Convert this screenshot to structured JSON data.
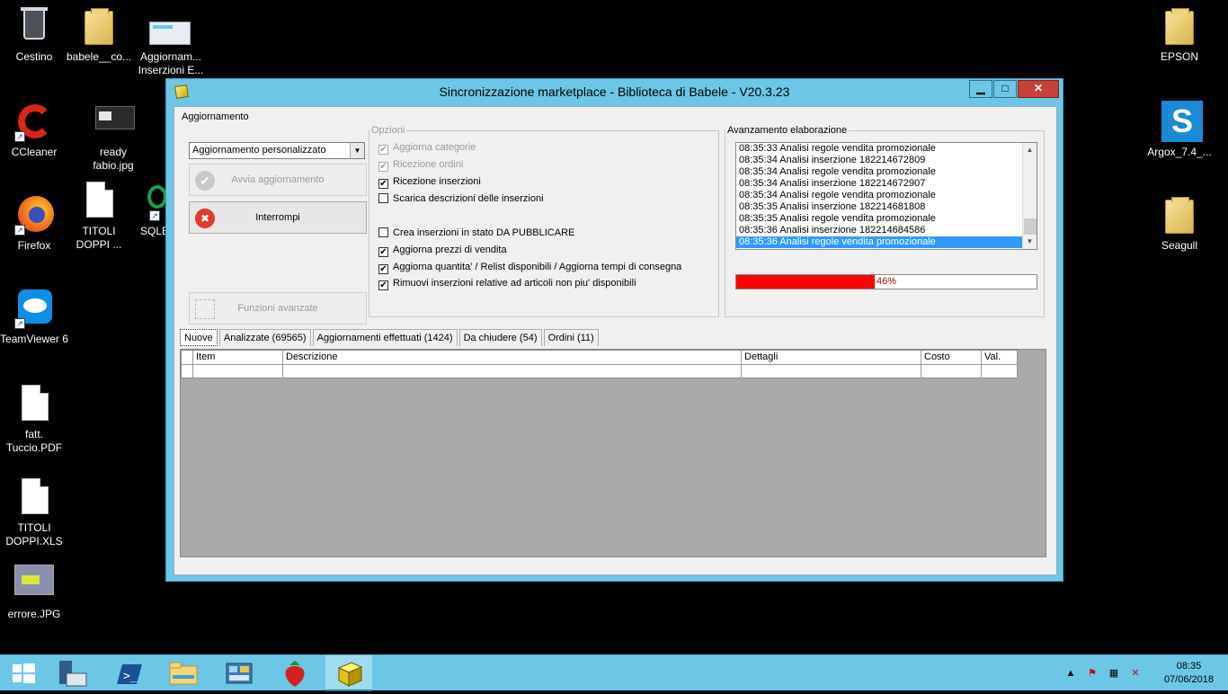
{
  "desktop": {
    "icons": [
      {
        "label": "Cestino",
        "icon": "recycle-bin-icon"
      },
      {
        "label": "babele__co...",
        "icon": "folder-icon"
      },
      {
        "label": "Aggiornam... Inserzioni E...",
        "icon": "screenshot-icon"
      },
      {
        "label": "CCleaner",
        "icon": "ccleaner-icon"
      },
      {
        "label": "ready fabio.jpg",
        "icon": "image-file-icon"
      },
      {
        "label": "TITOLI DOPPI ...",
        "icon": "document-icon"
      },
      {
        "label": "SQLB",
        "icon": "sql-icon"
      },
      {
        "label": "Firefox",
        "icon": "firefox-icon"
      },
      {
        "label": "TeamViewer 6",
        "icon": "teamviewer-icon"
      },
      {
        "label": "fatt. Tuccio.PDF",
        "icon": "document-icon"
      },
      {
        "label": "TITOLI DOPPI.XLS",
        "icon": "document-icon"
      },
      {
        "label": "errore.JPG",
        "icon": "image-file-icon"
      },
      {
        "label": "EPSON",
        "icon": "folder-icon"
      },
      {
        "label": "Argox_7.4_...",
        "icon": "argox-icon"
      },
      {
        "label": "Seagull",
        "icon": "folder-icon"
      }
    ]
  },
  "window": {
    "title": "Sincronizzazione marketplace - Biblioteca di Babele - V20.3.23",
    "controls": {
      "minimize": "▁",
      "maximize": "□",
      "close": "✕"
    }
  },
  "aggiornamento": {
    "legend": "Aggiornamento",
    "select_value": "Aggiornamento personalizzato",
    "start_button": "Avvia aggiornamento",
    "stop_button": "Interrompi",
    "advanced_button": "Funzioni avanzate"
  },
  "opzioni": {
    "legend": "Opzioni",
    "checkboxes": [
      {
        "label": "Aggiorna categorie",
        "checked": true,
        "enabled": false
      },
      {
        "label": "Ricezione ordini",
        "checked": true,
        "enabled": false
      },
      {
        "label": "Ricezione inserzioni",
        "checked": true,
        "enabled": true
      },
      {
        "label": "Scarica descrizioni delle inserzioni",
        "checked": false,
        "enabled": true
      },
      {
        "label": "Crea inserzioni in stato DA PUBBLICARE",
        "checked": false,
        "enabled": true
      },
      {
        "label": "Aggiorna prezzi di vendita",
        "checked": true,
        "enabled": true
      },
      {
        "label": "Aggiorna quantita' / Relist disponibili / Aggiorna tempi di consegna",
        "checked": true,
        "enabled": true
      },
      {
        "label": "Rimuovi inserzioni relative ad articoli non piu' disponibili",
        "checked": true,
        "enabled": true
      }
    ]
  },
  "avanzamento": {
    "legend": "Avanzamento elaborazione",
    "log": [
      "08:35:33 Analisi regole vendita promozionale",
      "08:35:34 Analisi inserzione 182214672809",
      "08:35:34 Analisi regole vendita promozionale",
      "08:35:34 Analisi inserzione 182214672907",
      "08:35:34 Analisi regole vendita promozionale",
      "08:35:35 Analisi inserzione 182214681808",
      "08:35:35 Analisi regole vendita promozionale",
      "08:35:36 Analisi inserzione 182214684586",
      "08:35:36 Analisi regole vendita promozionale"
    ],
    "progress_percent": 46,
    "progress_label": "46%",
    "progress_color": "#ff0000"
  },
  "tabs": [
    {
      "label": "Nuove",
      "active": true
    },
    {
      "label": "Analizzate (69565)",
      "active": false
    },
    {
      "label": "Aggiornamenti effettuati (1424)",
      "active": false
    },
    {
      "label": "Da chiudere (54)",
      "active": false
    },
    {
      "label": "Ordini (11)",
      "active": false
    }
  ],
  "grid": {
    "columns": [
      "Item",
      "Descrizione",
      "Dettagli",
      "Costo",
      "Val."
    ]
  },
  "taskbar": {
    "items": [
      "start-icon",
      "server-manager-icon",
      "powershell-icon",
      "file-explorer-icon",
      "control-panel-icon",
      "strawberry-icon",
      "babele-app-icon"
    ],
    "time": "08:35",
    "date": "07/06/2018"
  }
}
